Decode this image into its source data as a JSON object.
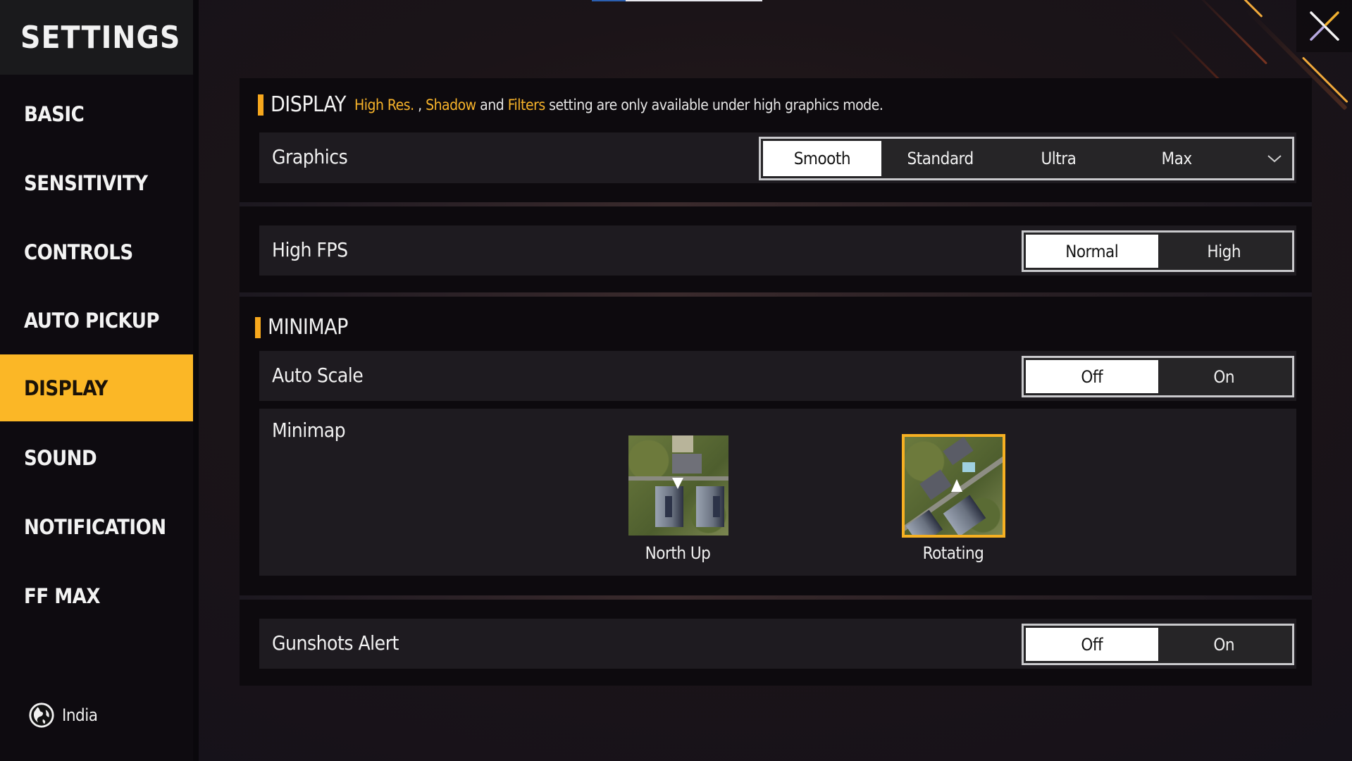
{
  "sidebar": {
    "title": "SETTINGS",
    "items": [
      {
        "label": "BASIC",
        "active": false
      },
      {
        "label": "SENSITIVITY",
        "active": false
      },
      {
        "label": "CONTROLS",
        "active": false
      },
      {
        "label": "AUTO PICKUP",
        "active": false
      },
      {
        "label": "DISPLAY",
        "active": true
      },
      {
        "label": "SOUND",
        "active": false
      },
      {
        "label": "NOTIFICATION",
        "active": false
      },
      {
        "label": "FF MAX",
        "active": false
      }
    ],
    "region": {
      "icon": "globe-icon",
      "label": "India"
    }
  },
  "close": {
    "icon": "close-icon"
  },
  "colors": {
    "accent": "#fbb726",
    "highlight_text": "#f7b32a",
    "selected_option_bg": "#ffffff"
  },
  "display_section": {
    "title": "DISPLAY",
    "note": {
      "hl1": "High Res.",
      "sep1": " , ",
      "hl2": "Shadow",
      "mid": " and ",
      "hl3": "Filters",
      "tail": " setting are only available under high graphics mode."
    },
    "graphics": {
      "label": "Graphics",
      "options": [
        "Smooth",
        "Standard",
        "Ultra",
        "Max"
      ],
      "selected": "Smooth",
      "dropdown_icon": "chevron-down-icon"
    },
    "high_fps": {
      "label": "High FPS",
      "options": [
        "Normal",
        "High"
      ],
      "selected": "Normal"
    }
  },
  "minimap_section": {
    "title": "MINIMAP",
    "auto_scale": {
      "label": "Auto Scale",
      "options": [
        "Off",
        "On"
      ],
      "selected": "Off"
    },
    "minimap": {
      "label": "Minimap",
      "options": [
        {
          "label": "North Up",
          "selected": false
        },
        {
          "label": "Rotating",
          "selected": true
        }
      ]
    }
  },
  "gunshots_alert": {
    "label": "Gunshots Alert",
    "options": [
      "Off",
      "On"
    ],
    "selected": "Off"
  }
}
